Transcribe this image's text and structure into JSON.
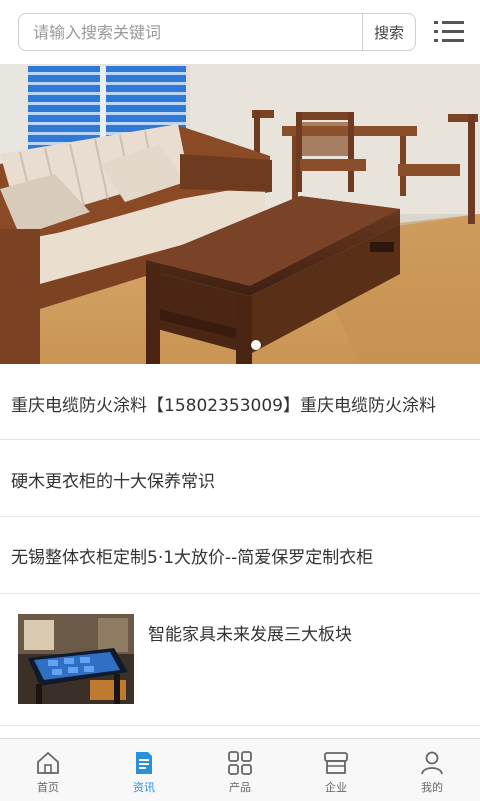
{
  "search": {
    "placeholder": "请输入搜索关键词",
    "button_label": "搜索"
  },
  "news": [
    {
      "title": "重庆电缆防火涂料【15802353009】重庆电缆防火涂料"
    },
    {
      "title": "硬木更衣柜的十大保养常识"
    },
    {
      "title": "无锡整体衣柜定制5·1大放价--简爱保罗定制衣柜"
    },
    {
      "title": "智能家具未来发展三大板块"
    }
  ],
  "tabs": [
    {
      "label": "首页",
      "icon": "home-icon"
    },
    {
      "label": "资讯",
      "icon": "news-icon",
      "active": true
    },
    {
      "label": "产品",
      "icon": "grid-icon"
    },
    {
      "label": "企业",
      "icon": "store-icon"
    },
    {
      "label": "我的",
      "icon": "user-icon"
    }
  ],
  "colors": {
    "accent": "#2a90d8",
    "divider": "#e3e3e3"
  }
}
